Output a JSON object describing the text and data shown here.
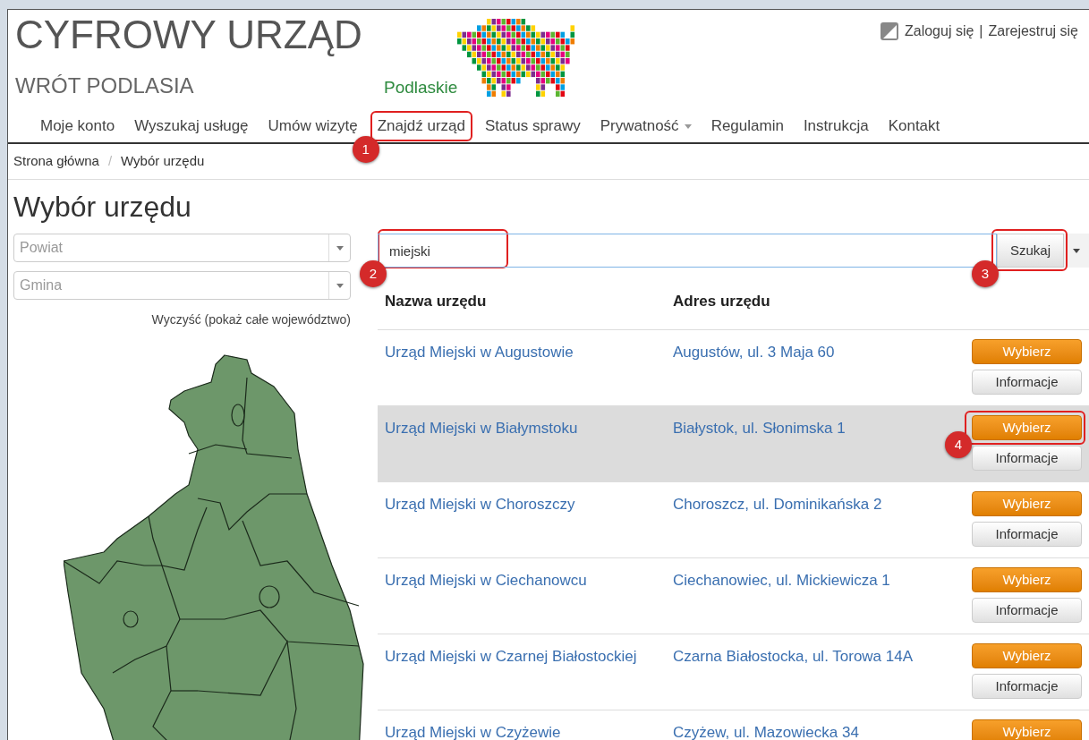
{
  "header": {
    "title": "CYFROWY URZĄD",
    "subtitle": "WRÓT PODLASIA",
    "logo_text": "Podlaskie",
    "user_links": [
      "Zaloguj się",
      "|",
      "Zarejestruj się"
    ]
  },
  "nav": [
    {
      "label": "Moje konto",
      "dropdown": false
    },
    {
      "label": "Wyszukaj usługę",
      "dropdown": false
    },
    {
      "label": "Umów wizytę",
      "dropdown": false
    },
    {
      "label": "Znajdź urząd",
      "dropdown": false,
      "callout": "1"
    },
    {
      "label": "Status sprawy",
      "dropdown": false
    },
    {
      "label": "Prywatność",
      "dropdown": true
    },
    {
      "label": "Regulamin",
      "dropdown": false
    },
    {
      "label": "Instrukcja",
      "dropdown": false
    },
    {
      "label": "Kontakt",
      "dropdown": false
    }
  ],
  "breadcrumb": [
    "Strona główna",
    "/",
    "Wybór urzędu"
  ],
  "heading": "Wybór urzędu",
  "filters": [
    {
      "placeholder": "Powiat"
    },
    {
      "placeholder": "Gmina"
    }
  ],
  "clear_link": "Wyczyść (pokaż całe województwo)",
  "search": {
    "value": "miejski",
    "callout": "2",
    "button": "Szukaj",
    "button_callout": "3"
  },
  "table": {
    "columns": [
      "Nazwa urzędu",
      "Adres urzędu"
    ],
    "rows": [
      {
        "name": "Urząd Miejski w Augustowie",
        "address": "Augustów, ul. 3 Maja 60",
        "selected": false,
        "select_button": "Wybierz",
        "info_button": "Informacje"
      },
      {
        "name": "Urząd Miejski w Białymstoku",
        "address": "Białystok, ul. Słonimska 1",
        "selected": true,
        "select_button": "Wybierz",
        "info_button": "Informacje",
        "callout": "4"
      },
      {
        "name": "Urząd Miejski w Choroszczy",
        "address": "Choroszcz, ul. Dominikańska 2",
        "selected": false,
        "select_button": "Wybierz",
        "info_button": "Informacje"
      },
      {
        "name": "Urząd Miejski w Ciechanowcu",
        "address": "Ciechanowiec, ul. Mickiewicza 1",
        "selected": false,
        "select_button": "Wybierz",
        "info_button": "Informacje"
      },
      {
        "name": "Urząd Miejski w Czarnej Białostockiej",
        "address": "Czarna Białostocka, ul. Torowa 14A",
        "selected": false,
        "select_button": "Wybierz",
        "info_button": "Informacje"
      },
      {
        "name": "Urząd Miejski w Czyżewie",
        "address": "Czyżew, ul. Mazowiecka 34",
        "selected": false,
        "select_button": "Wybierz"
      }
    ]
  }
}
